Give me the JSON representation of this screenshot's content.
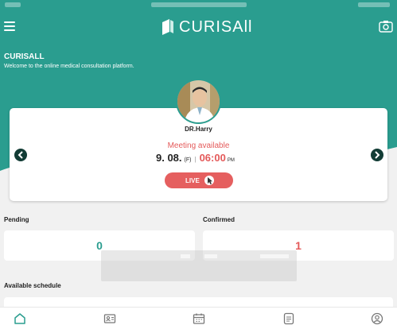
{
  "header": {
    "logo_text": "CURISAll",
    "app_title": "CURISALL",
    "subtitle": "Welcome to the online medical consultation platform."
  },
  "icons": {
    "menu": "menu-icon",
    "camera": "camera-switch-icon"
  },
  "doctor": {
    "name": "DR.Harry",
    "status": "Meeting available",
    "date": "9. 08.",
    "day": "(F)",
    "time": "06:00",
    "ampm": "PM",
    "live_label": "LIVE"
  },
  "stats": {
    "pending_label": "Pending",
    "pending_value": "0",
    "confirmed_label": "Confirmed",
    "confirmed_value": "1"
  },
  "schedule": {
    "label": "Available schedule"
  },
  "tabbar": [
    "home-icon",
    "profile-card-icon",
    "calendar-icon",
    "document-icon",
    "account-icon"
  ],
  "colors": {
    "primary": "#2a9d8f",
    "accent": "#e45a5a",
    "dark": "#123c35"
  }
}
